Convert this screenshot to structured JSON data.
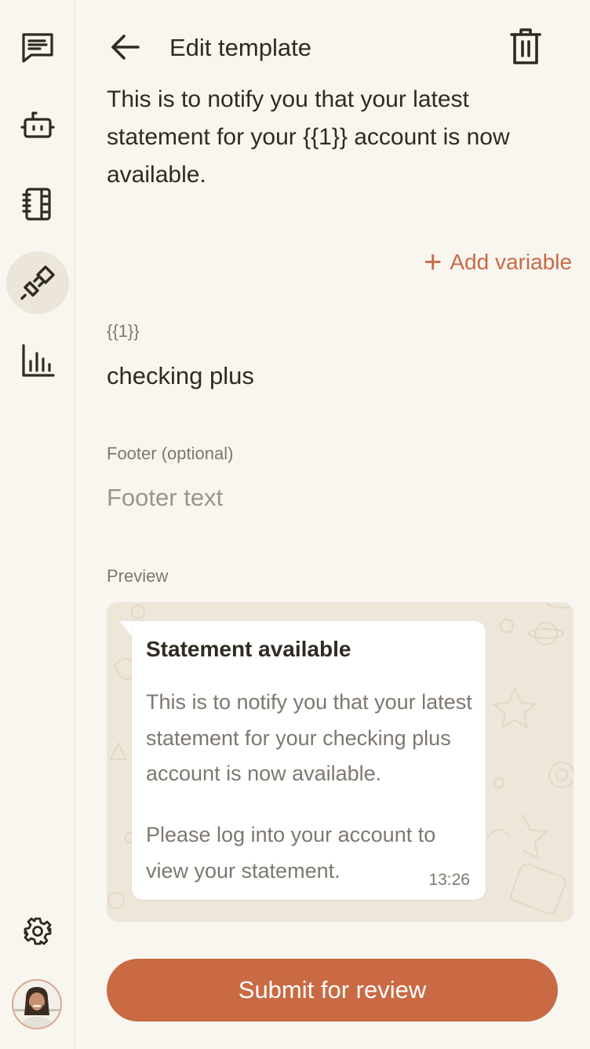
{
  "header": {
    "title": "Edit template",
    "back_icon": "arrow-left-icon",
    "delete_icon": "trash-icon"
  },
  "sidebar": {
    "items": [
      {
        "name": "chats",
        "icon": "chat-icon",
        "active": false
      },
      {
        "name": "bots",
        "icon": "robot-icon",
        "active": false
      },
      {
        "name": "contacts",
        "icon": "notebook-icon",
        "active": false
      },
      {
        "name": "integrations",
        "icon": "plug-icon",
        "active": true
      },
      {
        "name": "analytics",
        "icon": "bar-chart-icon",
        "active": false
      }
    ],
    "settings_icon": "gear-icon",
    "avatar": "user-avatar"
  },
  "template": {
    "body_text": "This is to notify you that your latest statement for your {{1}} account is now available.",
    "add_variable_label": "Add variable",
    "variable": {
      "label": "{{1}}",
      "value": "checking plus"
    },
    "footer": {
      "label": "Footer (optional)",
      "placeholder": "Footer text",
      "value": ""
    }
  },
  "preview": {
    "label": "Preview",
    "title": "Statement available",
    "body": "This is to notify you that your latest statement for your checking plus account is now available.",
    "footer": "Please log into your account to view your statement.",
    "time": "13:26"
  },
  "actions": {
    "submit_label": "Submit for review"
  },
  "colors": {
    "accent": "#c96a44",
    "background": "#f9f6f0",
    "text": "#2f2b22",
    "muted": "#7d786f",
    "preview_bg": "#ede6d9"
  }
}
